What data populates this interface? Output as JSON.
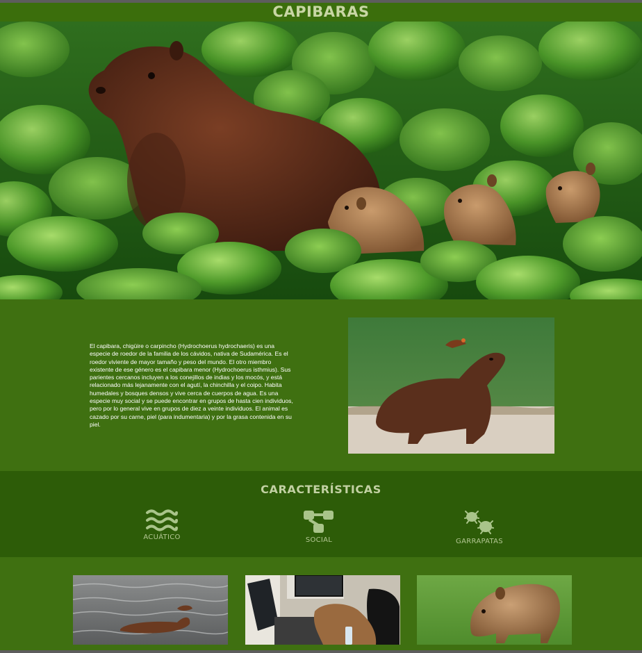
{
  "header": {
    "title": "CAPIBARAS"
  },
  "intro": {
    "text": "El capibara, chigüire o carpincho (Hydrochoerus hydrochaeris) es una especie de roedor de la familia de los cávidos, nativa de Sudamérica. Es el roedor viviente de mayor tamaño y peso del mundo. El otro miembro existente de ese género es el capibara menor (Hydrochoerus isthmius). Sus parientes cercanos incluyen a los conejillos de indias y los mocós, y está relacionado más lejanamente con el agutí, la chinchilla y el coipo. Habita humedales y bosques densos y vive cerca de cuerpos de agua. Es una especie muy social y se puede encontrar en grupos de hasta cien individuos, pero por lo general vive en grupos de diez a veinte individuos. El animal es cazado por su carne, piel (para indumentaria) y por la grasa contenida en su piel."
  },
  "features": {
    "title": "CARACTERÍSTICAS",
    "items": [
      {
        "label": "ACUÁTICO",
        "icon": "water-waves-icon"
      },
      {
        "label": "SOCIAL",
        "icon": "network-icon"
      },
      {
        "label": "GARRAPATAS",
        "icon": "ticks-icon"
      }
    ]
  },
  "colors": {
    "header_bg": "#3b6e0c",
    "body_bg": "#3f7011",
    "features_bg": "#2d5c08",
    "accent_text": "#c8d6a4"
  }
}
